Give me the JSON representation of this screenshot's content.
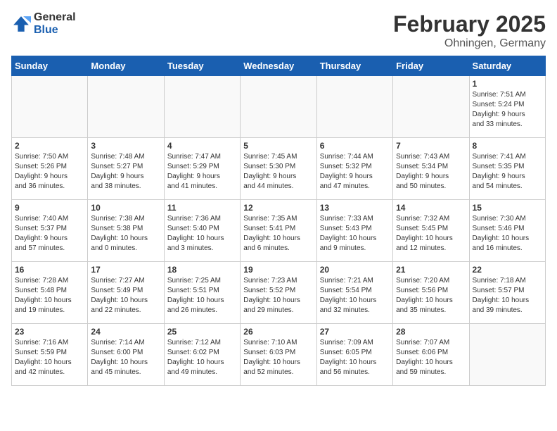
{
  "header": {
    "logo_general": "General",
    "logo_blue": "Blue",
    "title": "February 2025",
    "subtitle": "Ohningen, Germany"
  },
  "weekdays": [
    "Sunday",
    "Monday",
    "Tuesday",
    "Wednesday",
    "Thursday",
    "Friday",
    "Saturday"
  ],
  "weeks": [
    [
      {
        "day": "",
        "info": ""
      },
      {
        "day": "",
        "info": ""
      },
      {
        "day": "",
        "info": ""
      },
      {
        "day": "",
        "info": ""
      },
      {
        "day": "",
        "info": ""
      },
      {
        "day": "",
        "info": ""
      },
      {
        "day": "1",
        "info": "Sunrise: 7:51 AM\nSunset: 5:24 PM\nDaylight: 9 hours\nand 33 minutes."
      }
    ],
    [
      {
        "day": "2",
        "info": "Sunrise: 7:50 AM\nSunset: 5:26 PM\nDaylight: 9 hours\nand 36 minutes."
      },
      {
        "day": "3",
        "info": "Sunrise: 7:48 AM\nSunset: 5:27 PM\nDaylight: 9 hours\nand 38 minutes."
      },
      {
        "day": "4",
        "info": "Sunrise: 7:47 AM\nSunset: 5:29 PM\nDaylight: 9 hours\nand 41 minutes."
      },
      {
        "day": "5",
        "info": "Sunrise: 7:45 AM\nSunset: 5:30 PM\nDaylight: 9 hours\nand 44 minutes."
      },
      {
        "day": "6",
        "info": "Sunrise: 7:44 AM\nSunset: 5:32 PM\nDaylight: 9 hours\nand 47 minutes."
      },
      {
        "day": "7",
        "info": "Sunrise: 7:43 AM\nSunset: 5:34 PM\nDaylight: 9 hours\nand 50 minutes."
      },
      {
        "day": "8",
        "info": "Sunrise: 7:41 AM\nSunset: 5:35 PM\nDaylight: 9 hours\nand 54 minutes."
      }
    ],
    [
      {
        "day": "9",
        "info": "Sunrise: 7:40 AM\nSunset: 5:37 PM\nDaylight: 9 hours\nand 57 minutes."
      },
      {
        "day": "10",
        "info": "Sunrise: 7:38 AM\nSunset: 5:38 PM\nDaylight: 10 hours\nand 0 minutes."
      },
      {
        "day": "11",
        "info": "Sunrise: 7:36 AM\nSunset: 5:40 PM\nDaylight: 10 hours\nand 3 minutes."
      },
      {
        "day": "12",
        "info": "Sunrise: 7:35 AM\nSunset: 5:41 PM\nDaylight: 10 hours\nand 6 minutes."
      },
      {
        "day": "13",
        "info": "Sunrise: 7:33 AM\nSunset: 5:43 PM\nDaylight: 10 hours\nand 9 minutes."
      },
      {
        "day": "14",
        "info": "Sunrise: 7:32 AM\nSunset: 5:45 PM\nDaylight: 10 hours\nand 12 minutes."
      },
      {
        "day": "15",
        "info": "Sunrise: 7:30 AM\nSunset: 5:46 PM\nDaylight: 10 hours\nand 16 minutes."
      }
    ],
    [
      {
        "day": "16",
        "info": "Sunrise: 7:28 AM\nSunset: 5:48 PM\nDaylight: 10 hours\nand 19 minutes."
      },
      {
        "day": "17",
        "info": "Sunrise: 7:27 AM\nSunset: 5:49 PM\nDaylight: 10 hours\nand 22 minutes."
      },
      {
        "day": "18",
        "info": "Sunrise: 7:25 AM\nSunset: 5:51 PM\nDaylight: 10 hours\nand 26 minutes."
      },
      {
        "day": "19",
        "info": "Sunrise: 7:23 AM\nSunset: 5:52 PM\nDaylight: 10 hours\nand 29 minutes."
      },
      {
        "day": "20",
        "info": "Sunrise: 7:21 AM\nSunset: 5:54 PM\nDaylight: 10 hours\nand 32 minutes."
      },
      {
        "day": "21",
        "info": "Sunrise: 7:20 AM\nSunset: 5:56 PM\nDaylight: 10 hours\nand 35 minutes."
      },
      {
        "day": "22",
        "info": "Sunrise: 7:18 AM\nSunset: 5:57 PM\nDaylight: 10 hours\nand 39 minutes."
      }
    ],
    [
      {
        "day": "23",
        "info": "Sunrise: 7:16 AM\nSunset: 5:59 PM\nDaylight: 10 hours\nand 42 minutes."
      },
      {
        "day": "24",
        "info": "Sunrise: 7:14 AM\nSunset: 6:00 PM\nDaylight: 10 hours\nand 45 minutes."
      },
      {
        "day": "25",
        "info": "Sunrise: 7:12 AM\nSunset: 6:02 PM\nDaylight: 10 hours\nand 49 minutes."
      },
      {
        "day": "26",
        "info": "Sunrise: 7:10 AM\nSunset: 6:03 PM\nDaylight: 10 hours\nand 52 minutes."
      },
      {
        "day": "27",
        "info": "Sunrise: 7:09 AM\nSunset: 6:05 PM\nDaylight: 10 hours\nand 56 minutes."
      },
      {
        "day": "28",
        "info": "Sunrise: 7:07 AM\nSunset: 6:06 PM\nDaylight: 10 hours\nand 59 minutes."
      },
      {
        "day": "",
        "info": ""
      }
    ]
  ]
}
